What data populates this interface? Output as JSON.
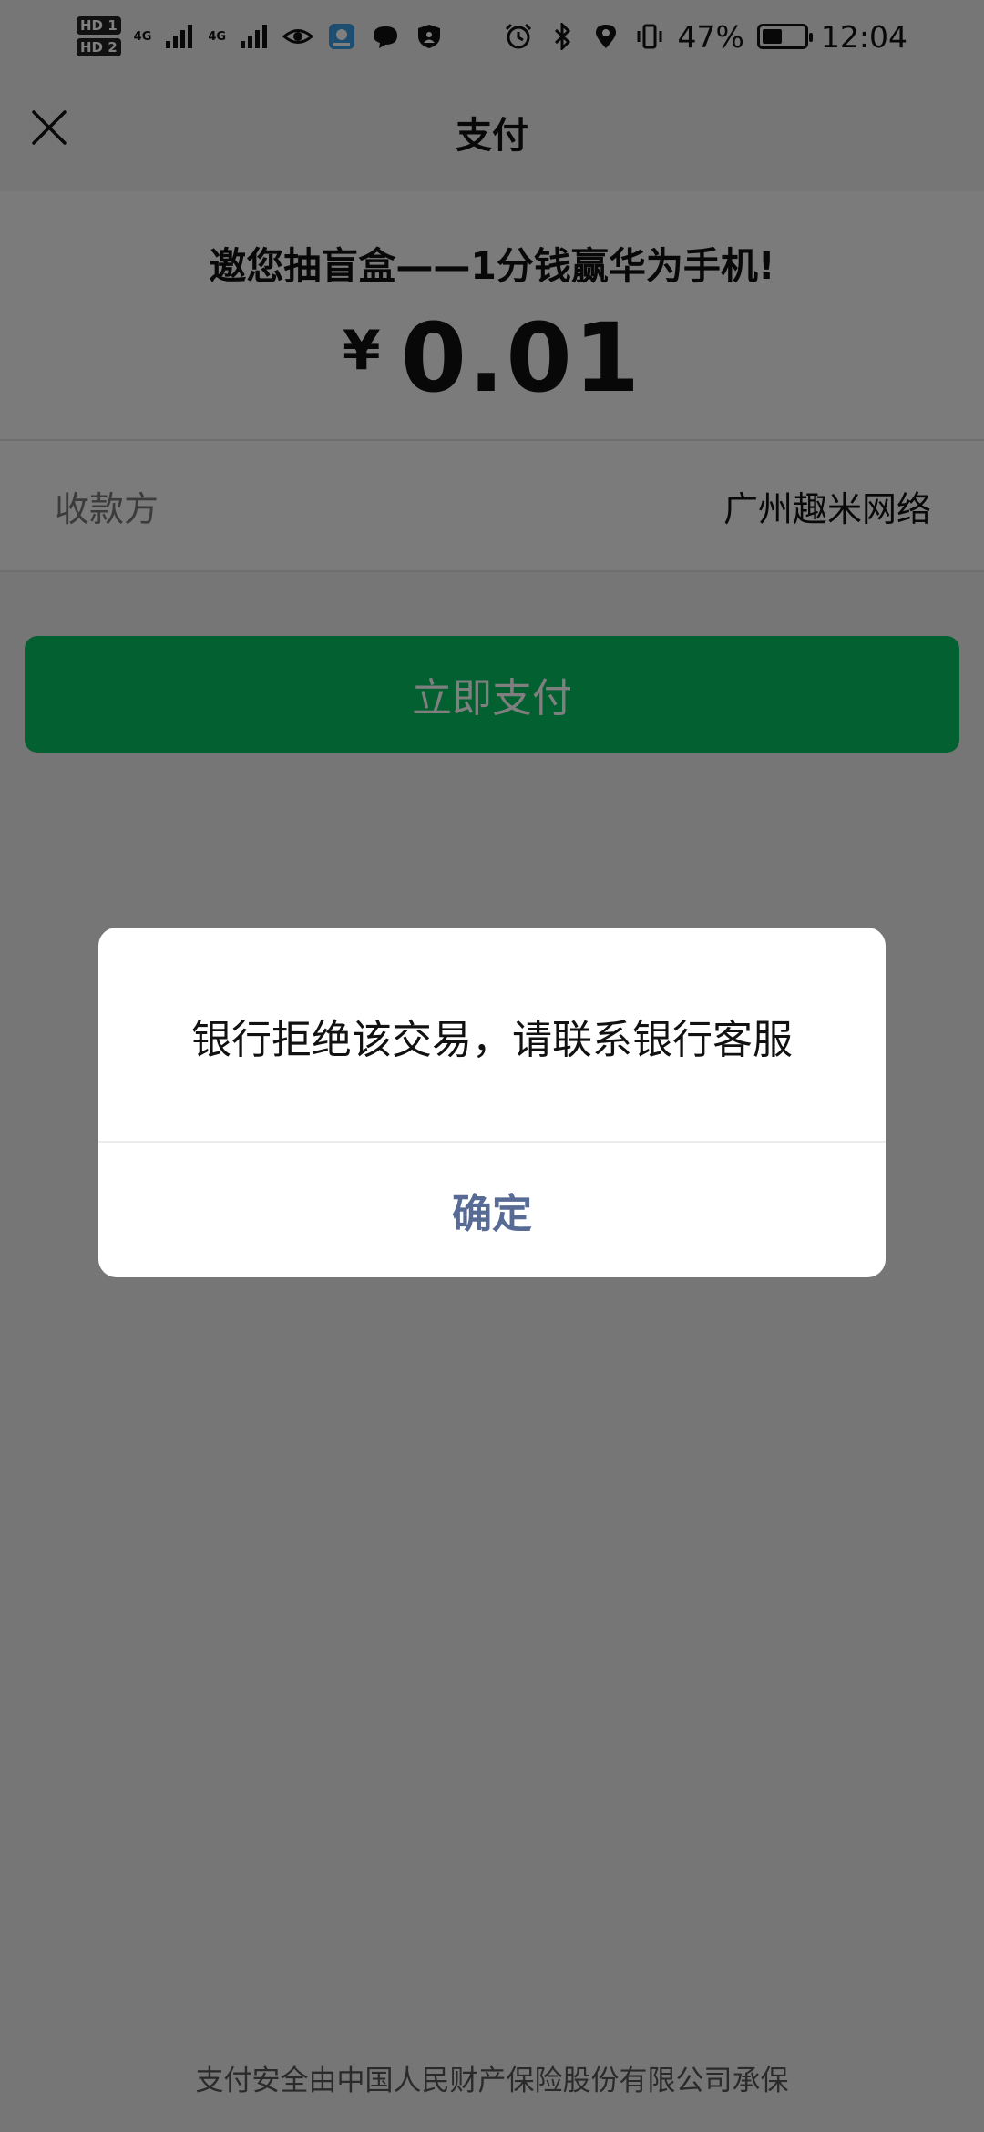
{
  "status_bar": {
    "hd1": "HD 1",
    "hd2": "HD 2",
    "net1": "4G",
    "net2": "4G",
    "battery_percent_text": "47%",
    "battery_level": 0.47,
    "time": "12:04"
  },
  "nav": {
    "title": "支付",
    "close_icon": "close-icon"
  },
  "order": {
    "promo_text": "邀您抽盲盒——1分钱赢华为手机!",
    "currency": "¥",
    "amount": "0.01"
  },
  "payee": {
    "label": "收款方",
    "value": "广州趣米网络"
  },
  "pay_button": {
    "label": "立即支付",
    "color": "#07c160"
  },
  "footer": {
    "text": "支付安全由中国人民财产保险股份有限公司承保"
  },
  "dialog": {
    "message": "银行拒绝该交易，请联系银行客服",
    "confirm_label": "确定",
    "confirm_color": "#576b95"
  }
}
